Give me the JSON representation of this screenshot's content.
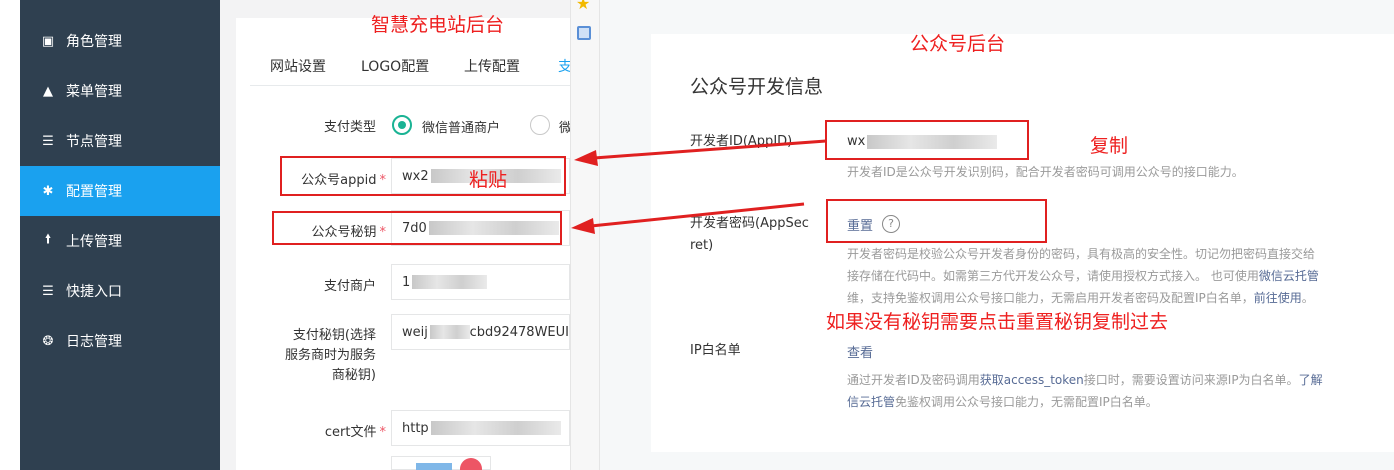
{
  "sidebar": {
    "items": [
      {
        "label": "角色管理",
        "icon": "role-icon"
      },
      {
        "label": "菜单管理",
        "icon": "tree-icon"
      },
      {
        "label": "节点管理",
        "icon": "list-icon"
      },
      {
        "label": "配置管理",
        "icon": "gear-icon"
      },
      {
        "label": "上传管理",
        "icon": "upload-arrow-icon"
      },
      {
        "label": "快捷入口",
        "icon": "list-icon"
      },
      {
        "label": "日志管理",
        "icon": "log-icon"
      }
    ],
    "active_color": "#1aa1ef"
  },
  "admin": {
    "tabs": [
      "网站设置",
      "LOGO配置",
      "上传配置",
      "支"
    ],
    "pay_type_label": "支付类型",
    "pay_type_option1": "微信普通商户",
    "pay_type_option2": "微",
    "appid_label": "公众号appid",
    "appid_value": "wx2",
    "secret_label": "公众号秘钥",
    "secret_value": "7d0",
    "merchant_label": "支付商户",
    "merchant_value": "1",
    "paykey_label_l1": "支付秘钥(选择",
    "paykey_label_l2": "服务商时为服务",
    "paykey_label_l3": "商秘钥)",
    "paykey_value": "weij",
    "paykey_value_tail": "cbd92478WEUI",
    "cert_label": "cert文件",
    "cert_value": "http",
    "required_mark": "*"
  },
  "wechat": {
    "title": "公众号开发信息",
    "appid_label": "开发者ID(AppID)",
    "appid_value": "wx",
    "appid_desc": "开发者ID是公众号开发识别码，配合开发者密码可调用公众号的接口能力。",
    "secret_label_l1": "开发者密码(AppSec",
    "secret_label_l2": "ret)",
    "reset_link": "重置",
    "help_icon": "?",
    "secret_desc_l1": "开发者密码是校验公众号开发者身份的密码，具有极高的安全性。切记勿把密码直接交给",
    "secret_desc_l2a": "接存储在代码中。如需第三方代开发公众号，请使用授权方式接入。 也可使用",
    "secret_desc_l2_link": "微信云托管",
    "secret_desc_l3a": "维，支持免鉴权调用公众号接口能力，无需启用开发者密码及配置IP白名单，",
    "secret_desc_l3_link": "前往使用",
    "secret_desc_l3_end": "。",
    "ip_label": "IP白名单",
    "ip_link": "查看",
    "ip_desc_l1a": "通过开发者ID及密码调用",
    "ip_desc_l1_link": "获取access_token",
    "ip_desc_l1b": "接口时，需要设置访问来源IP为白名单。",
    "ip_desc_l1_link2": "了解",
    "ip_desc_l2_link": "信云托管",
    "ip_desc_l2b": "免鉴权调用公众号接口能力，无需配置IP白名单。"
  },
  "annotations": {
    "admin_title": "智慧充电站后台",
    "wechat_title": "公众号后台",
    "paste": "粘贴",
    "copy": "复制",
    "reset_hint": "如果没有秘钥需要点击重置秘钥复制过去",
    "color": "#e02020"
  }
}
